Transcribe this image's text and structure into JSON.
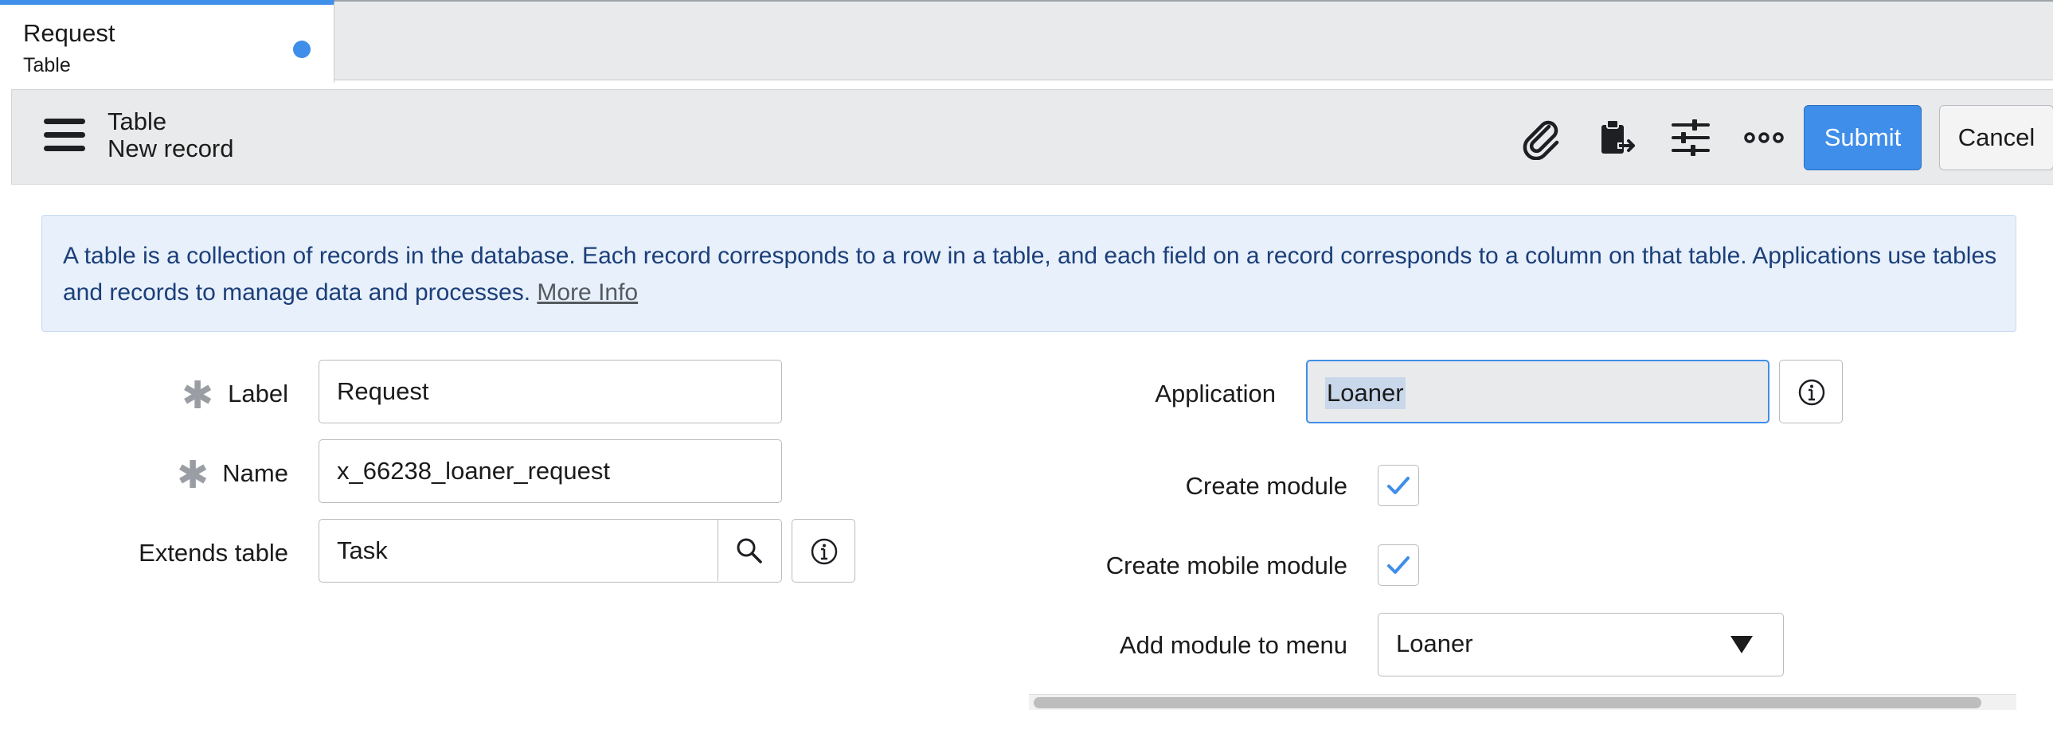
{
  "tab": {
    "title": "Request",
    "subtitle": "Table"
  },
  "header": {
    "title": "Table",
    "subtitle": "New record",
    "submit_label": "Submit",
    "cancel_label": "Cancel",
    "icons": [
      "paperclip-icon",
      "clipboard-export-icon",
      "sliders-icon",
      "more-options-icon"
    ]
  },
  "info": {
    "text": "A table is a collection of records in the database. Each record corresponds to a row in a table, and each field on a record corresponds to a column on that table. Applications use tables and records to manage data and processes.",
    "link": "More Info"
  },
  "form": {
    "label": {
      "label": "Label",
      "value": "Request"
    },
    "name": {
      "label": "Name",
      "value": "x_66238_loaner_request"
    },
    "extends": {
      "label": "Extends table",
      "value": "Task"
    },
    "application": {
      "label": "Application",
      "value": "Loaner"
    },
    "create_module": {
      "label": "Create module",
      "checked": true
    },
    "create_mobile_module": {
      "label": "Create mobile module",
      "checked": true
    },
    "add_module_menu": {
      "label": "Add module to menu",
      "value": "Loaner"
    }
  },
  "colors": {
    "accent": "#3f8ee9",
    "banner_bg": "#e7f0fb",
    "banner_text": "#1c3f7a"
  }
}
